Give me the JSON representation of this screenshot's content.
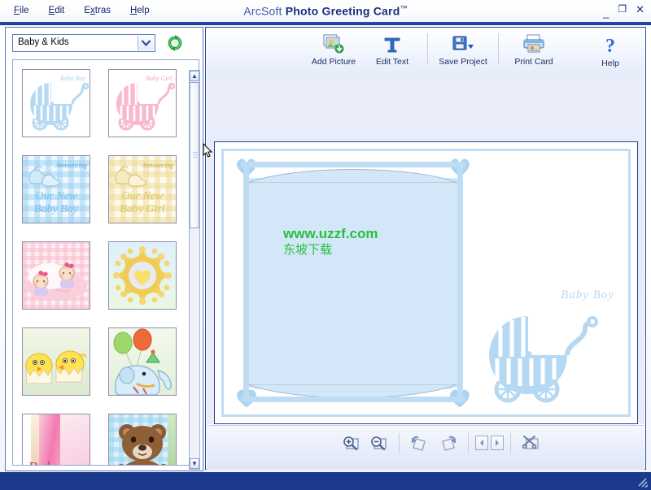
{
  "window": {
    "title_brand": "ArcSoft",
    "title_product": "Photo Greeting Card",
    "title_tm": "™",
    "minimize": "_",
    "maximize": "❐",
    "close": "✕"
  },
  "menu": {
    "items": [
      {
        "pre": "F",
        "key": "i",
        "post": "le",
        "name": "file"
      },
      {
        "pre": "E",
        "key": "d",
        "post": "it",
        "name": "edit"
      },
      {
        "pre": "E",
        "key": "x",
        "post": "tras",
        "name": "extras"
      },
      {
        "pre": "H",
        "key": "e",
        "post": "lp",
        "name": "help"
      }
    ],
    "labels": [
      "File",
      "Edit",
      "Extras",
      "Help"
    ]
  },
  "sidebar": {
    "category_selected": "Baby & Kids",
    "category_options": [
      "Baby & Kids"
    ],
    "refresh_tooltip": "Refresh",
    "scroll": {
      "up": "▲",
      "down": "▼"
    },
    "templates": [
      {
        "name": "baby-boy-carriage",
        "title": "Baby Boy",
        "style": "pram-blue"
      },
      {
        "name": "baby-girl-carriage",
        "title": "Baby Girl",
        "style": "pram-pink"
      },
      {
        "name": "announcing-our-new-baby-boy",
        "line1": "Announcing",
        "line2": "Our New",
        "line3": "Baby Boy",
        "style": "gingham-blue"
      },
      {
        "name": "announcing-our-new-baby-girl",
        "line1": "Announcing",
        "line2": "Our New",
        "line3": "Baby Girl",
        "style": "gingham-yellow"
      },
      {
        "name": "two-babies-pink",
        "title": "",
        "style": "babies-pink"
      },
      {
        "name": "sun-with-heart",
        "title": "",
        "style": "sun-heart"
      },
      {
        "name": "yellow-chicks",
        "title": "",
        "style": "chicks"
      },
      {
        "name": "party-elephant-balloons",
        "title": "",
        "style": "elephant"
      },
      {
        "name": "baby-pink-curtain",
        "title": "Baby",
        "style": "baby-pink"
      },
      {
        "name": "teddy-bear",
        "title": "",
        "style": "teddy"
      }
    ]
  },
  "toolbar": {
    "add_picture": "Add Picture",
    "edit_text": "Edit Text",
    "save_project": "Save Project",
    "print_card": "Print Card",
    "help": "Help"
  },
  "canvas": {
    "watermark_line1": "www.uzzf.com",
    "watermark_line2": "东坡下载",
    "card_caption": "Baby Boy"
  },
  "bottom_toolbar": {
    "zoom_in": "zoom-in",
    "zoom_out": "zoom-out",
    "rotate_left": "rotate-left",
    "rotate_right": "rotate-right",
    "prev_page": "◀",
    "next_page": "▶",
    "delete": "delete"
  },
  "statusbar": {
    "text": ""
  },
  "colors": {
    "accent": "#1b3a8c",
    "title": "#1e3b8e",
    "card_blue": "#bfdcf5",
    "page_blue": "#d4e7f9",
    "watermark_green": "#22c03c",
    "pram_blue": "#a9d4f2",
    "pram_pink": "#f6b9cd"
  }
}
